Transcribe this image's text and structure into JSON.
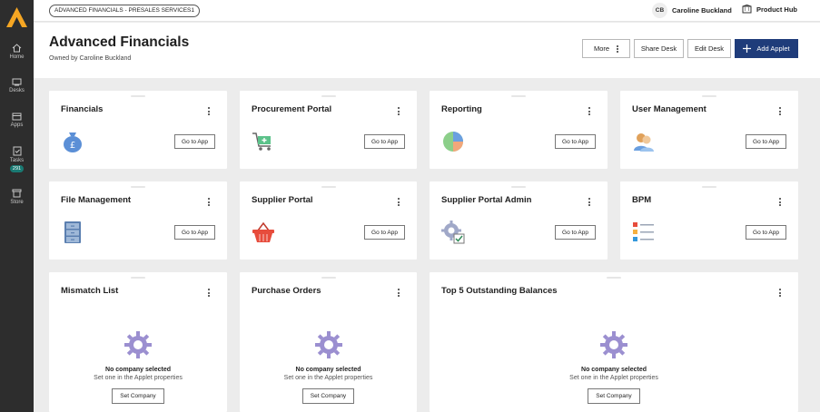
{
  "rail": {
    "items": [
      {
        "label": "Home",
        "icon": "home-icon"
      },
      {
        "label": "Desks",
        "icon": "desks-icon"
      },
      {
        "label": "Apps",
        "icon": "apps-icon"
      },
      {
        "label": "Tasks",
        "icon": "tasks-icon",
        "badge": "291"
      },
      {
        "label": "Store",
        "icon": "store-icon"
      }
    ]
  },
  "topbar": {
    "breadcrumb": "ADVANCED FINANCIALS - PRESALES SERVICES1",
    "user_initials": "CB",
    "user_name": "Caroline Buckland",
    "product_hub": "Product Hub"
  },
  "header": {
    "title": "Advanced Financials",
    "owner": "Owned by Caroline Buckland",
    "more_label": "More",
    "share_label": "Share Desk",
    "edit_label": "Edit Desk",
    "add_label": "Add Applet"
  },
  "apps": [
    {
      "title": "Financials",
      "button": "Go to App",
      "icon": "money-bag-icon"
    },
    {
      "title": "Procurement Portal",
      "button": "Go to App",
      "icon": "shopping-cart-icon"
    },
    {
      "title": "Reporting",
      "button": "Go to App",
      "icon": "pie-chart-icon"
    },
    {
      "title": "User Management",
      "button": "Go to App",
      "icon": "users-icon"
    },
    {
      "title": "File Management",
      "button": "Go to App",
      "icon": "filing-cabinet-icon"
    },
    {
      "title": "Supplier Portal",
      "button": "Go to App",
      "icon": "basket-icon"
    },
    {
      "title": "Supplier Portal Admin",
      "button": "Go to App",
      "icon": "gear-check-icon"
    },
    {
      "title": "BPM",
      "button": "Go to App",
      "icon": "checklist-icon"
    }
  ],
  "widgets": [
    {
      "title": "Mismatch List",
      "line1": "No company selected",
      "line2": "Set one in the Applet properties",
      "button": "Set Company"
    },
    {
      "title": "Purchase Orders",
      "line1": "No company selected",
      "line2": "Set one in the Applet properties",
      "button": "Set Company"
    },
    {
      "title": "Top 5 Outstanding Balances",
      "line1": "No company selected",
      "line2": "Set one in the Applet properties",
      "button": "Set Company"
    }
  ],
  "colors": {
    "rail_bg": "#2d2d2d",
    "accent": "#1f3c7a",
    "logo": "#f5a623",
    "badge": "#1a7a73"
  }
}
